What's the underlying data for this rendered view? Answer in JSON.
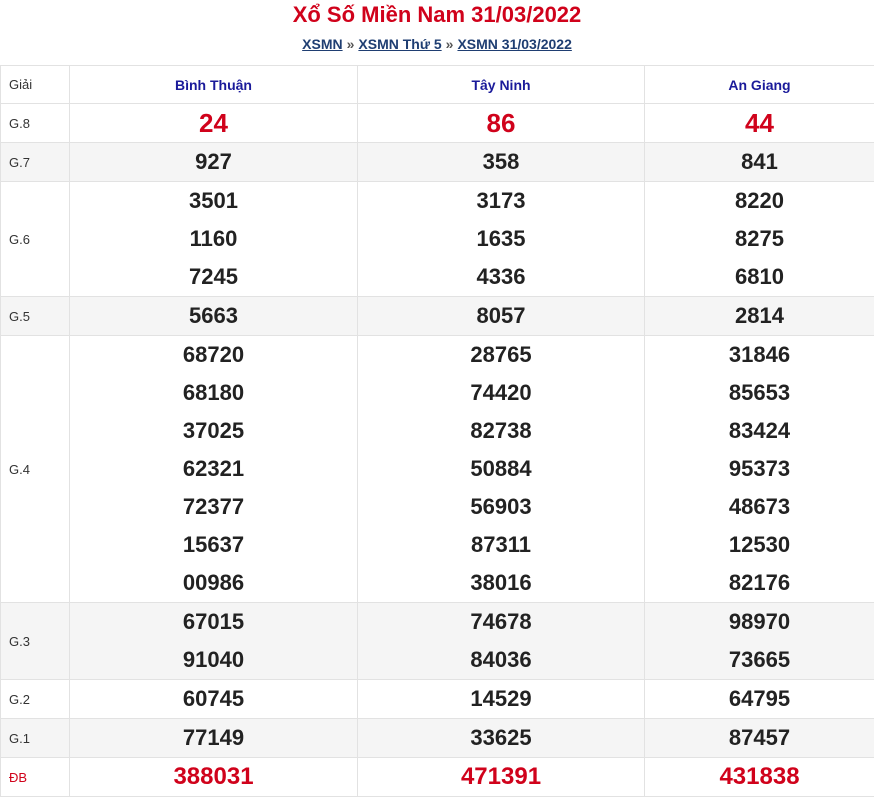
{
  "title": "Xổ Số Miền Nam 31/03/2022",
  "breadcrumb": {
    "items": [
      "XSMN",
      "XSMN Thứ 5",
      "XSMN 31/03/2022"
    ],
    "separator": "»"
  },
  "header": {
    "giai": "Giải",
    "provinces": [
      "Bình Thuận",
      "Tây Ninh",
      "An Giang"
    ]
  },
  "rows": [
    {
      "label": "G.8",
      "values": [
        [
          "24"
        ],
        [
          "86"
        ],
        [
          "44"
        ]
      ]
    },
    {
      "label": "G.7",
      "values": [
        [
          "927"
        ],
        [
          "358"
        ],
        [
          "841"
        ]
      ]
    },
    {
      "label": "G.6",
      "values": [
        [
          "3501",
          "1160",
          "7245"
        ],
        [
          "3173",
          "1635",
          "4336"
        ],
        [
          "8220",
          "8275",
          "6810"
        ]
      ]
    },
    {
      "label": "G.5",
      "values": [
        [
          "5663"
        ],
        [
          "8057"
        ],
        [
          "2814"
        ]
      ]
    },
    {
      "label": "G.4",
      "values": [
        [
          "68720",
          "68180",
          "37025",
          "62321",
          "72377",
          "15637",
          "00986"
        ],
        [
          "28765",
          "74420",
          "82738",
          "50884",
          "56903",
          "87311",
          "38016"
        ],
        [
          "31846",
          "85653",
          "83424",
          "95373",
          "48673",
          "12530",
          "82176"
        ]
      ]
    },
    {
      "label": "G.3",
      "values": [
        [
          "67015",
          "91040"
        ],
        [
          "74678",
          "84036"
        ],
        [
          "98970",
          "73665"
        ]
      ]
    },
    {
      "label": "G.2",
      "values": [
        [
          "60745"
        ],
        [
          "14529"
        ],
        [
          "64795"
        ]
      ]
    },
    {
      "label": "G.1",
      "values": [
        [
          "77149"
        ],
        [
          "33625"
        ],
        [
          "87457"
        ]
      ]
    },
    {
      "label": "ĐB",
      "values": [
        [
          "388031"
        ],
        [
          "471391"
        ],
        [
          "431838"
        ]
      ]
    }
  ],
  "colors": {
    "accent_red": "#d0021b",
    "header_blue": "#1a1a9a",
    "link_blue": "#1f3e72"
  }
}
